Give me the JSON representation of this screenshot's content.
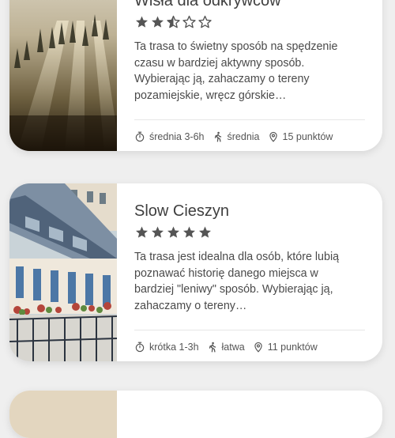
{
  "routes": [
    {
      "title": "Wisła dla odkrywców",
      "rating": 2.5,
      "description": "Ta trasa to świetny sposób na spędzenie czasu w bardziej aktywny sposób. Wybierając ją, zahaczamy o tereny pozamiejskie, wręcz górskie…",
      "duration": "średnia 3-6h",
      "difficulty": "średnia",
      "points": "15 punktów",
      "image": "misty-forest-sunrays"
    },
    {
      "title": "Slow Cieszyn",
      "rating": 5,
      "description": "Ta trasa jest idealna dla osób, które lubią poznawać historię danego miejsca w bardziej \"leniwy\" sposób. Wybierając ją, zahaczamy o tereny…",
      "duration": "krótka 1-3h",
      "difficulty": "łatwa",
      "points": "11 punktów",
      "image": "painted-townhouse-balconies"
    }
  ],
  "icons": {
    "duration": "stopwatch-icon",
    "difficulty": "hiker-icon",
    "points": "map-pin-icon",
    "star": "star-icon"
  },
  "colors": {
    "background": "#efefef",
    "card": "#ffffff",
    "star": "#555555",
    "text": "#4a4a4a"
  }
}
